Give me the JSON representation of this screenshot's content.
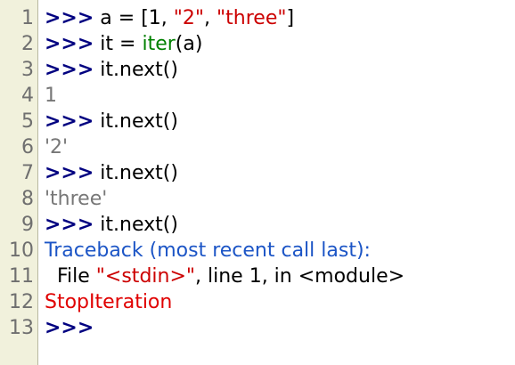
{
  "colors": {
    "gutter_bg": "#f1f1dc",
    "line_number": "#6f6f6f",
    "prompt": "#000080",
    "string": "#cc0000",
    "builtin": "#008000",
    "output": "#777777",
    "traceback": "#1c55c6",
    "exception": "#e00000"
  },
  "lines": [
    {
      "n": "1",
      "segments": [
        {
          "t": ">>>",
          "c": "prompt"
        },
        {
          "t": " a = [1, ",
          "c": "plain"
        },
        {
          "t": "\"2\"",
          "c": "str"
        },
        {
          "t": ", ",
          "c": "plain"
        },
        {
          "t": "\"three\"",
          "c": "str"
        },
        {
          "t": "]",
          "c": "plain"
        }
      ]
    },
    {
      "n": "2",
      "segments": [
        {
          "t": ">>>",
          "c": "prompt"
        },
        {
          "t": " it = ",
          "c": "plain"
        },
        {
          "t": "iter",
          "c": "builtin"
        },
        {
          "t": "(a)",
          "c": "plain"
        }
      ]
    },
    {
      "n": "3",
      "segments": [
        {
          "t": ">>>",
          "c": "prompt"
        },
        {
          "t": " it.next()",
          "c": "plain"
        }
      ]
    },
    {
      "n": "4",
      "segments": [
        {
          "t": "1",
          "c": "out"
        }
      ]
    },
    {
      "n": "5",
      "segments": [
        {
          "t": ">>>",
          "c": "prompt"
        },
        {
          "t": " it.next()",
          "c": "plain"
        }
      ]
    },
    {
      "n": "6",
      "segments": [
        {
          "t": "'2'",
          "c": "out"
        }
      ]
    },
    {
      "n": "7",
      "segments": [
        {
          "t": ">>>",
          "c": "prompt"
        },
        {
          "t": " it.next()",
          "c": "plain"
        }
      ]
    },
    {
      "n": "8",
      "segments": [
        {
          "t": "'three'",
          "c": "out"
        }
      ]
    },
    {
      "n": "9",
      "segments": [
        {
          "t": ">>>",
          "c": "prompt"
        },
        {
          "t": " it.next()",
          "c": "plain"
        }
      ]
    },
    {
      "n": "10",
      "segments": [
        {
          "t": "Traceback (most recent call last):",
          "c": "err"
        }
      ]
    },
    {
      "n": "11",
      "segments": [
        {
          "t": "  File ",
          "c": "plain"
        },
        {
          "t": "\"<stdin>\"",
          "c": "str"
        },
        {
          "t": ", line 1, in <module>",
          "c": "plain"
        }
      ]
    },
    {
      "n": "12",
      "segments": [
        {
          "t": "StopIteration",
          "c": "exc"
        }
      ]
    },
    {
      "n": "13",
      "segments": [
        {
          "t": ">>>",
          "c": "prompt"
        }
      ]
    }
  ]
}
